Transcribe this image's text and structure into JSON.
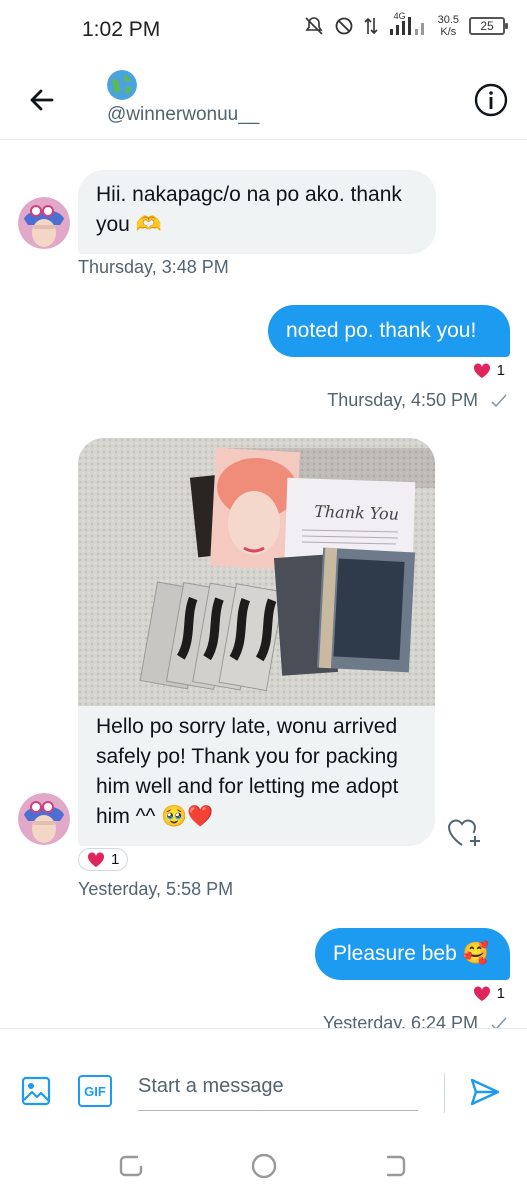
{
  "status_bar": {
    "time": "1:02 PM",
    "network": "4G",
    "speed_value": "30.5",
    "speed_unit": "K/s",
    "battery": "25"
  },
  "header": {
    "handle": "@winnerwonuu__",
    "back_icon": "arrow-left-icon",
    "info_icon": "info-icon"
  },
  "messages": [
    {
      "direction": "incoming",
      "text": "Hii. nakapagc/o na po ako. thank you 🫶",
      "timestamp": "Thursday, 3:48 PM"
    },
    {
      "direction": "outgoing",
      "text": "noted po. thank you!",
      "reaction_count": "1",
      "timestamp": "Thursday, 4:50 PM"
    },
    {
      "direction": "incoming",
      "has_image": true,
      "text": "Hello po sorry late, wonu arrived safely po! Thank you for packing him well and for letting me adopt him ^^ 🥹❤️",
      "reaction_count": "1",
      "timestamp": "Yesterday, 5:58 PM"
    },
    {
      "direction": "outgoing",
      "text": "Pleasure beb 🥰",
      "reaction_count": "1",
      "timestamp": "Yesterday, 6:24 PM"
    }
  ],
  "photo_card_text": "Thank You",
  "composer": {
    "placeholder": "Start a message",
    "gif_label": "GIF"
  },
  "colors": {
    "accent": "#1d9bf0",
    "bubble_incoming": "#eff3f4",
    "heart": "#f91880",
    "text_secondary": "#536471"
  }
}
